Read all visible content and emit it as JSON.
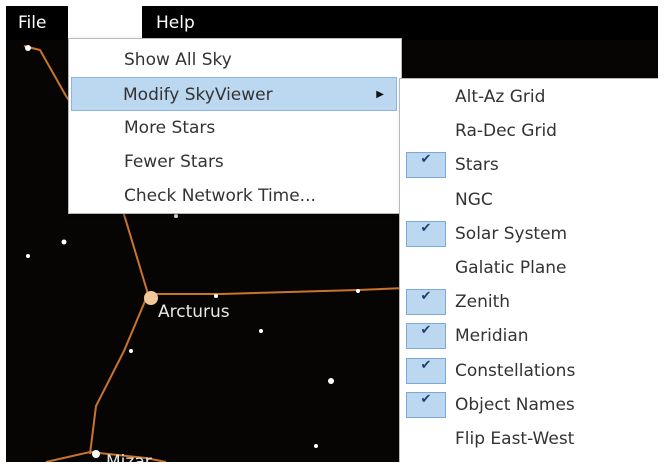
{
  "menubar": {
    "items": [
      {
        "label": "File"
      },
      {
        "label": ""
      },
      {
        "label": "Help"
      }
    ]
  },
  "view_menu": {
    "items": [
      {
        "label": "Show All Sky",
        "highlighted": false,
        "has_submenu": false
      },
      {
        "label": "Modify SkyViewer",
        "highlighted": true,
        "has_submenu": true
      },
      {
        "label": "More Stars",
        "highlighted": false,
        "has_submenu": false
      },
      {
        "label": "Fewer Stars",
        "highlighted": false,
        "has_submenu": false
      },
      {
        "label": "Check Network Time...",
        "highlighted": false,
        "has_submenu": false
      }
    ],
    "submenu_arrow_icon": "triangle-right-icon"
  },
  "submenu": {
    "items": [
      {
        "label": "Alt-Az Grid",
        "checked": false
      },
      {
        "label": "Ra-Dec Grid",
        "checked": false
      },
      {
        "label": "Stars",
        "checked": true
      },
      {
        "label": "NGC",
        "checked": false
      },
      {
        "label": "Solar System",
        "checked": true
      },
      {
        "label": "Galatic Plane",
        "checked": false
      },
      {
        "label": "Zenith",
        "checked": true
      },
      {
        "label": "Meridian",
        "checked": true
      },
      {
        "label": "Constellations",
        "checked": true
      },
      {
        "label": "Object Names",
        "checked": true
      },
      {
        "label": "Flip East-West",
        "checked": false
      }
    ],
    "check_glyph": "✔",
    "check_icon": "checkmark-icon"
  },
  "sky": {
    "labels": [
      {
        "text": "Arcturus"
      },
      {
        "text": "Mizar"
      }
    ],
    "colors": {
      "background": "#070503",
      "constellation_line": "#c8742c",
      "star": "#ffffff",
      "bright_star": "#f2c89a"
    }
  }
}
